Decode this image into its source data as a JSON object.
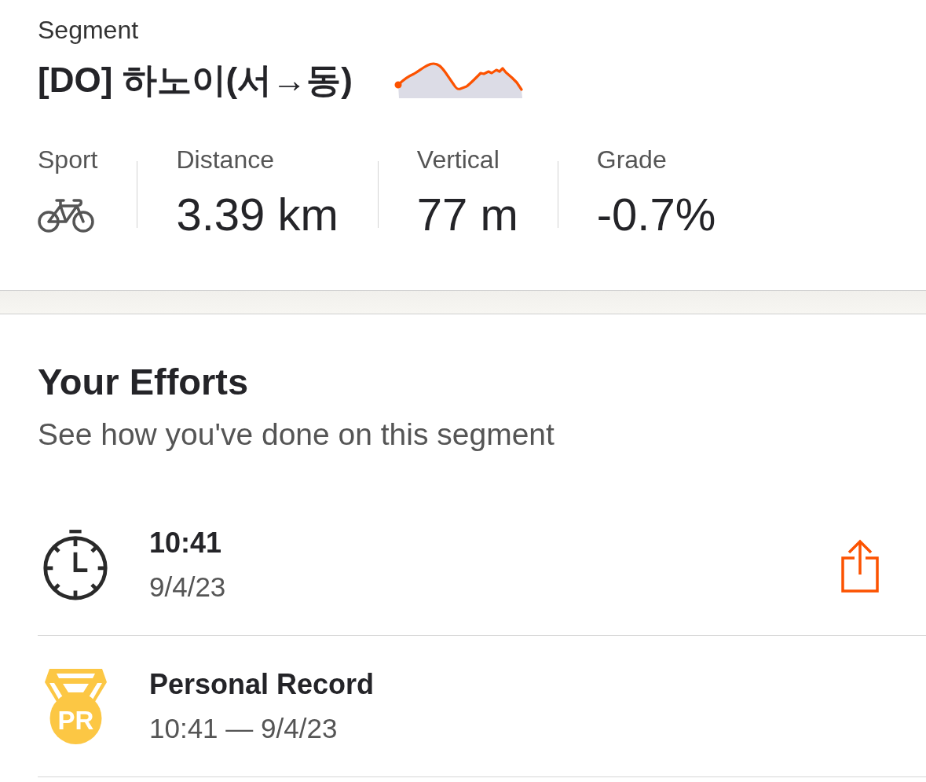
{
  "header": {
    "label": "Segment",
    "title": "[DO] 하노이(서→동)"
  },
  "stats": [
    {
      "kind": "icon",
      "label": "Sport"
    },
    {
      "kind": "value",
      "label": "Distance",
      "value": "3.39 km"
    },
    {
      "kind": "value",
      "label": "Vertical",
      "value": "77 m"
    },
    {
      "kind": "value",
      "label": "Grade",
      "value": "-0.7%"
    }
  ],
  "efforts": {
    "title": "Your Efforts",
    "subtitle": "See how you've done on this segment",
    "rows": [
      {
        "kind": "time",
        "title": "10:41",
        "detail": "9/4/23",
        "share_button": true
      },
      {
        "kind": "pr",
        "badge": "PR",
        "title": "Personal Record",
        "detail": "10:41 — 9/4/23",
        "share_button": false
      }
    ]
  }
}
